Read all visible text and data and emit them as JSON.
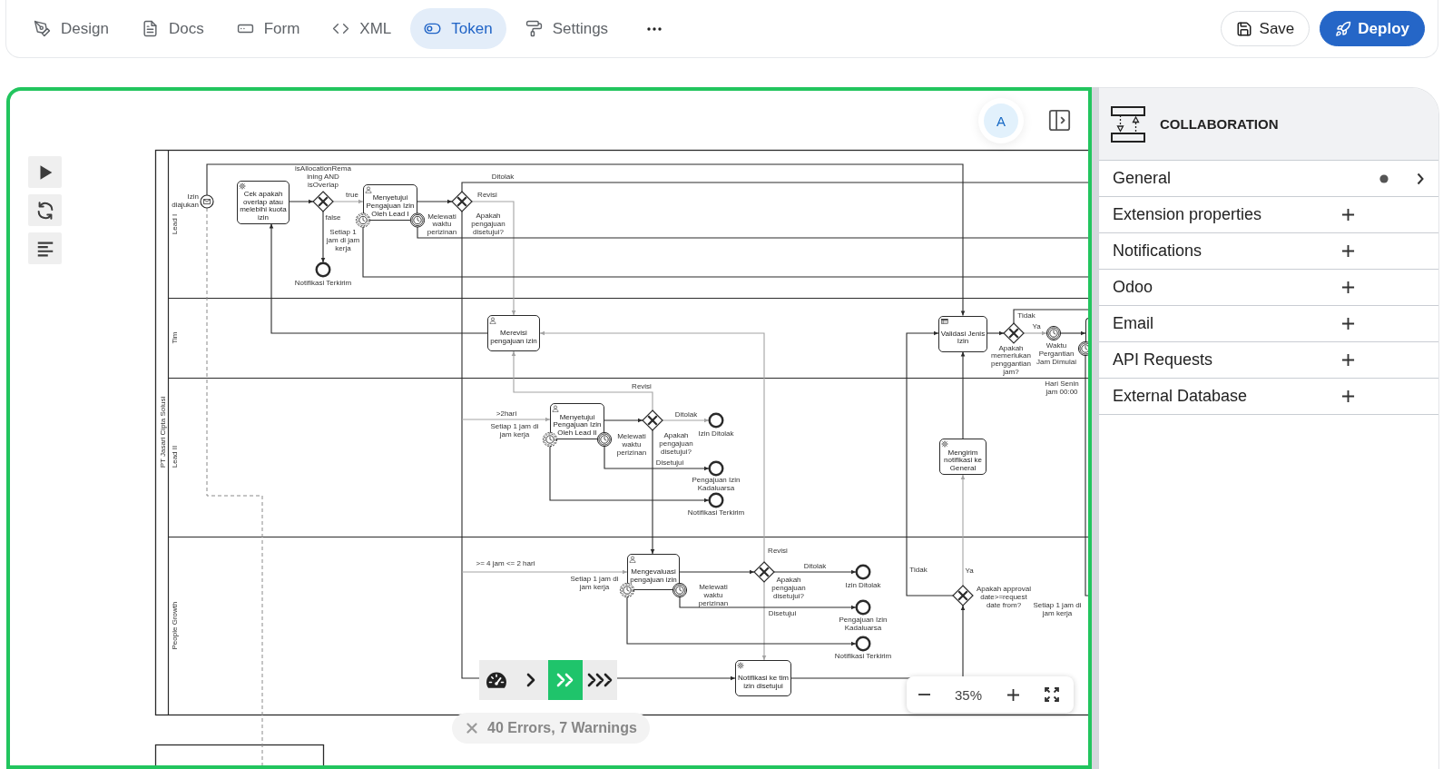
{
  "topbar": {
    "tabs": [
      {
        "label": "Design",
        "selected": false
      },
      {
        "label": "Docs",
        "selected": false
      },
      {
        "label": "Form",
        "selected": false
      },
      {
        "label": "XML",
        "selected": false
      },
      {
        "label": "Token",
        "selected": true
      },
      {
        "label": "Settings",
        "selected": false
      }
    ],
    "actions": [
      {
        "label": "Save",
        "kind": "secondary"
      },
      {
        "label": "Deploy",
        "kind": "primary"
      }
    ]
  },
  "canvas": {
    "avatar": "A",
    "speed_options": [
      {
        "selected": false
      },
      {
        "selected": true
      },
      {
        "selected": false
      }
    ],
    "validation": "40 Errors, 7 Warnings",
    "zoom": "35%",
    "diagram": {
      "pool": "PT Jasari Cipta Solusi",
      "lanes": [
        "Lead I",
        "Tim",
        "Lead II",
        "People Growth"
      ],
      "nodes": [
        {
          "kind": "message-start",
          "label": "Izin diajukan"
        },
        {
          "kind": "service-task",
          "label": "Cek apakah overlap atau melebihi kuota izin"
        },
        {
          "kind": "exclusive-gateway",
          "label": "isAllocationRemaining AND isOverlap"
        },
        {
          "kind": "end",
          "label": "Notifikasi Terkirim"
        },
        {
          "kind": "user-task",
          "label": "Menyetujui Pengajuan Izin Oleh Lead I"
        },
        {
          "kind": "timer-boundary",
          "interrupting": false,
          "label": "Setiap 1 jam di jam kerja"
        },
        {
          "kind": "timer-boundary",
          "interrupting": true,
          "label": "Melewati waktu perizinan"
        },
        {
          "kind": "exclusive-gateway",
          "label": "Apakah pengajuan disetujui?"
        },
        {
          "kind": "user-task",
          "label": "Merevisi pengajuan izin"
        },
        {
          "kind": "user-task",
          "label": "Menyetujui Pengajuan Izin Oleh Lead II"
        },
        {
          "kind": "timer-boundary",
          "interrupting": false,
          "label": "Setiap 1 jam di jam kerja"
        },
        {
          "kind": "timer-boundary",
          "interrupting": true,
          "label": "Melewati waktu perizinan"
        },
        {
          "kind": "exclusive-gateway",
          "label": "Apakah pengajuan disetujui?"
        },
        {
          "kind": "end",
          "label": "Izin Ditolak"
        },
        {
          "kind": "end",
          "label": "Pengajuan Izin Kadaluarsa"
        },
        {
          "kind": "end",
          "label": "Notifikasi Terkirim"
        },
        {
          "kind": "user-task",
          "label": "Mengevaluasi pengajuan izin"
        },
        {
          "kind": "timer-boundary",
          "interrupting": false,
          "label": "Setiap 1 jam di jam kerja"
        },
        {
          "kind": "timer-boundary",
          "interrupting": true,
          "label": "Melewati waktu perizinan"
        },
        {
          "kind": "exclusive-gateway",
          "label": "Apakah pengajuan disetujui?"
        },
        {
          "kind": "end",
          "label": "Izin Ditolak"
        },
        {
          "kind": "end",
          "label": "Pengajuan Izin Kadaluarsa"
        },
        {
          "kind": "end",
          "label": "Notifikasi Terkirim"
        },
        {
          "kind": "service-task",
          "label": "Notifikasi ke tim izin disetujui"
        },
        {
          "kind": "rule-task",
          "label": "Validasi Jenis Izin"
        },
        {
          "kind": "exclusive-gateway",
          "label": "Apakah memerlukan penggantian jam?"
        },
        {
          "kind": "timer-catch",
          "label": "Waktu Pergantian Jam Dimulai"
        },
        {
          "kind": "task"
        },
        {
          "kind": "timer-boundary",
          "interrupting": true,
          "label": "Hari Senin jam 00:00"
        },
        {
          "kind": "service-task",
          "label": "Mengirim notifikasi ke General"
        },
        {
          "kind": "exclusive-gateway",
          "label": "Apakah approval date>=request date from?"
        }
      ],
      "flow_labels": [
        "true",
        "false",
        "Ditolak",
        "Revisi",
        "Revisi",
        ">2hari",
        "Ditolak",
        "Disetujui",
        ">= 4 jam <= 2 hari",
        "Revisi",
        "Ditolak",
        "Disetujui",
        "Tidak",
        "Ya",
        "Tidak",
        "Ya",
        "Setiap 1 jam di jam kerja"
      ]
    }
  },
  "properties": {
    "title": "COLLABORATION",
    "groups": [
      {
        "label": "General",
        "kind": "link",
        "changed": true
      },
      {
        "label": "Extension properties",
        "kind": "add",
        "changed": false
      },
      {
        "label": "Notifications",
        "kind": "add",
        "changed": false
      },
      {
        "label": "Odoo",
        "kind": "add",
        "changed": false
      },
      {
        "label": "Email",
        "kind": "add",
        "changed": false
      },
      {
        "label": "API Requests",
        "kind": "add",
        "changed": false
      },
      {
        "label": "External Database",
        "kind": "add",
        "changed": false
      }
    ]
  }
}
